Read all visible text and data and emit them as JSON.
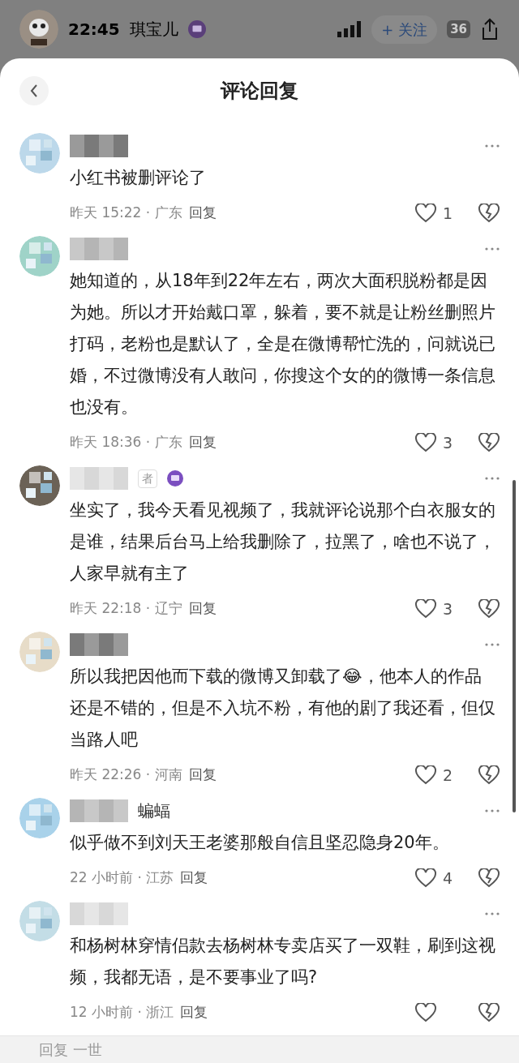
{
  "status_bar": {
    "time": "22:45",
    "battery": "36"
  },
  "header": {
    "user_name": "琪宝儿",
    "follow_button": "+ 关注"
  },
  "sheet": {
    "title": "评论回复"
  },
  "comments": [
    {
      "text": "小红书被删评论了",
      "meta": "昨天 15:22 · 广东",
      "reply": "回复",
      "likes": "1"
    },
    {
      "text": "她知道的，从18年到22年左右，两次大面积脱粉都是因为她。所以才开始戴口罩，躲着，要不就是让粉丝删照片打码，老粉也是默认了，全是在微博帮忙洗的，问就说已婚，不过微博没有人敢问，你搜这个女的的微博一条信息也没有。",
      "meta": "昨天 18:36 · 广东",
      "reply": "回复",
      "likes": "3"
    },
    {
      "name_tag": "者",
      "text": "坐实了，我今天看见视频了，我就评论说那个白衣服女的是谁，结果后台马上给我删除了，拉黑了，啥也不说了，人家早就有主了",
      "meta": "昨天 22:18 · 辽宁",
      "reply": "回复",
      "likes": "3"
    },
    {
      "text": "所以我把因他而下载的微博又卸载了😂，他本人的作品还是不错的，但是不入坑不粉，有他的剧了我还看，但仅当路人吧",
      "meta": "昨天 22:26 · 河南",
      "reply": "回复",
      "likes": "2"
    },
    {
      "name": "蝙蝠",
      "text": "似乎做不到刘天王老婆那般自信且坚忍隐身20年。",
      "meta": "22 小时前 · 江苏",
      "reply": "回复",
      "likes": "4"
    },
    {
      "text": "和杨树林穿情侣款去杨树林专卖店买了一双鞋，刷到这视频，我都无语，是不要事业了吗?",
      "meta": "12 小时前 · 浙江",
      "reply": "回复"
    }
  ],
  "reply_bar": {
    "placeholder": "回复 一世"
  }
}
